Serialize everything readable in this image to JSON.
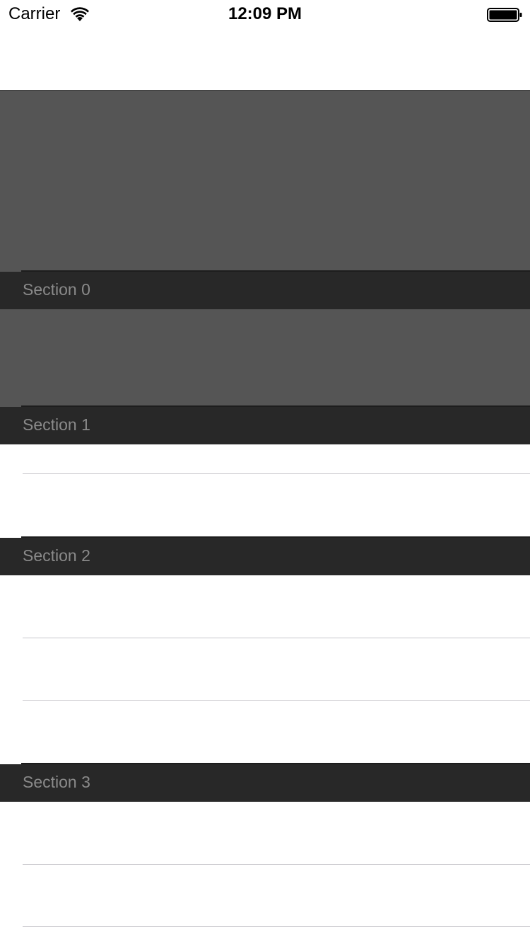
{
  "status_bar": {
    "carrier": "Carrier",
    "time": "12:09 PM",
    "wifi_icon": "wifi-icon",
    "battery_icon": "battery-icon"
  },
  "colors": {
    "header_bg": "#282828",
    "header_text": "#8a8a8a",
    "dark_cell": "#555555",
    "separator": "#c8c7cc"
  },
  "sections": [
    {
      "title": "Section 0",
      "rows": 1
    },
    {
      "title": "Section 1",
      "rows": 2
    },
    {
      "title": "Section 2",
      "rows": 3
    },
    {
      "title": "Section 3",
      "rows": 2
    }
  ]
}
